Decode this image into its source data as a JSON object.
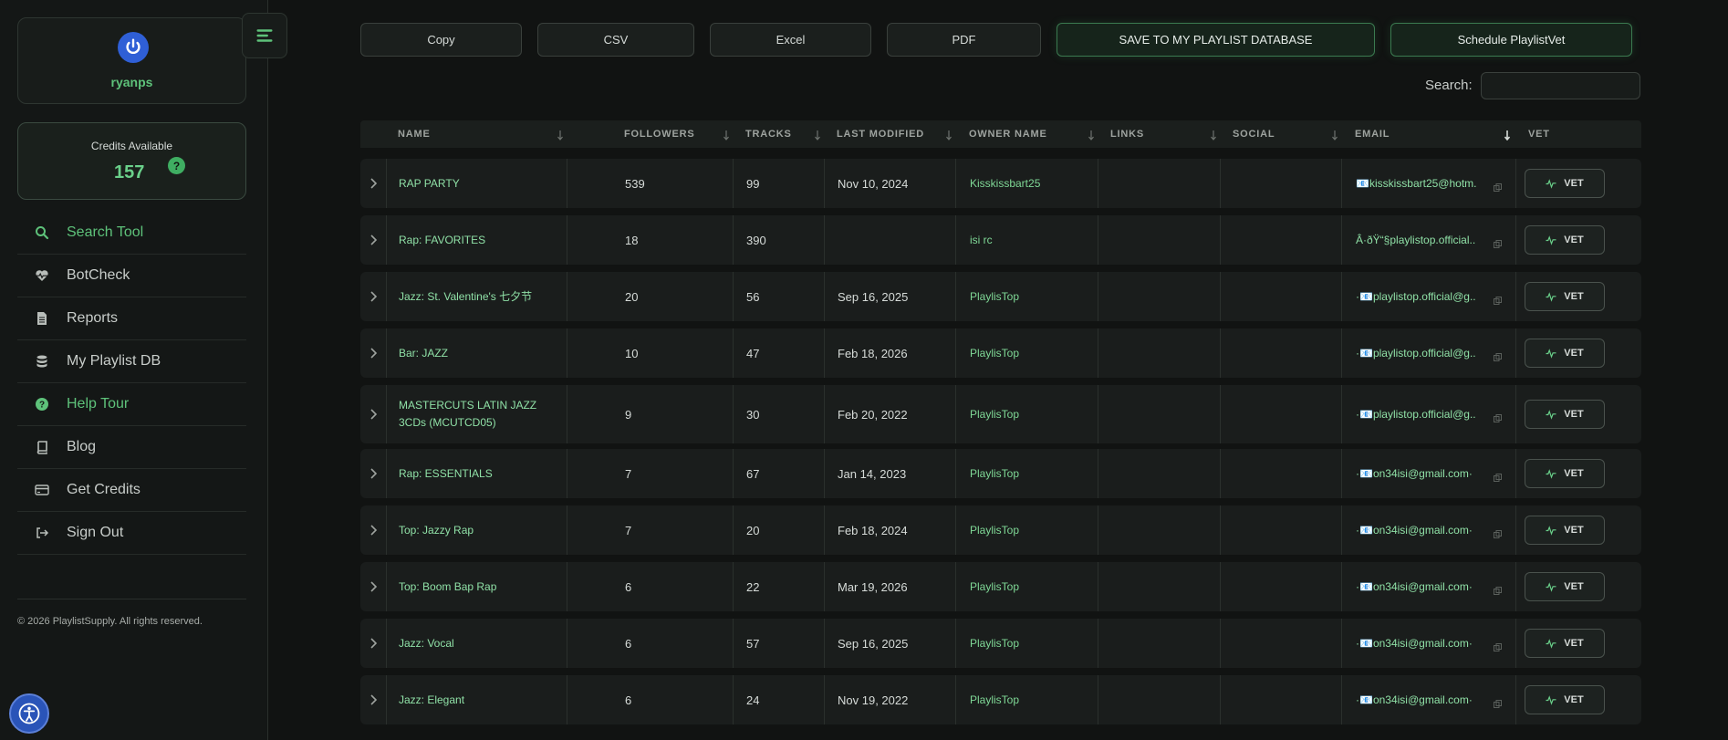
{
  "sidebar": {
    "username": "ryanps",
    "credits_label": "Credits Available",
    "credits_value": "157",
    "help_badge": "?",
    "nav": [
      {
        "label": "Search Tool",
        "icon": "search-icon",
        "state": "active"
      },
      {
        "label": "BotCheck",
        "icon": "heart-pulse-icon",
        "state": ""
      },
      {
        "label": "Reports",
        "icon": "document-icon",
        "state": ""
      },
      {
        "label": "My Playlist DB",
        "icon": "database-icon",
        "state": ""
      },
      {
        "label": "Help Tour",
        "icon": "question-circle-icon",
        "state": "accent"
      },
      {
        "label": "Blog",
        "icon": "book-icon",
        "state": ""
      },
      {
        "label": "Get Credits",
        "icon": "credit-card-icon",
        "state": ""
      },
      {
        "label": "Sign Out",
        "icon": "sign-out-icon",
        "state": ""
      }
    ],
    "copyright": "© 2026 PlaylistSupply. All rights reserved."
  },
  "toolbar": {
    "copy": "Copy",
    "csv": "CSV",
    "excel": "Excel",
    "pdf": "PDF",
    "save_db": "SAVE TO MY PLAYLIST DATABASE",
    "schedule": "Schedule PlaylistVet"
  },
  "search": {
    "label": "Search:",
    "value": ""
  },
  "table": {
    "columns": [
      "NAME",
      "FOLLOWERS",
      "TRACKS",
      "LAST MODIFIED",
      "OWNER NAME",
      "LINKS",
      "SOCIAL",
      "EMAIL",
      "VET"
    ],
    "vet_label": "VET",
    "rows": [
      {
        "name": "RAP PARTY",
        "followers": "539",
        "tracks": "99",
        "last_modified": "Nov 10, 2024",
        "owner": "Kisskissbart25",
        "links": "",
        "social": "",
        "email": "📧kisskissbart25@hotm..."
      },
      {
        "name": "Rap: FAVORITES",
        "followers": "18",
        "tracks": "390",
        "last_modified": "",
        "owner": "isi rc",
        "links": "",
        "social": "",
        "email": "Â·ðŸ“§playlistop.official..."
      },
      {
        "name": "Jazz: St. Valentine's 七夕节",
        "followers": "20",
        "tracks": "56",
        "last_modified": "Sep 16, 2025",
        "owner": "PlaylisTop",
        "links": "",
        "social": "",
        "email": "·📧playlistop.official@g..."
      },
      {
        "name": "Bar: JAZZ",
        "followers": "10",
        "tracks": "47",
        "last_modified": "Feb 18, 2026",
        "owner": "PlaylisTop",
        "links": "",
        "social": "",
        "email": "·📧playlistop.official@g..."
      },
      {
        "name": "MASTERCUTS LATIN JAZZ 3CDs (MCUTCD05)",
        "followers": "9",
        "tracks": "30",
        "last_modified": "Feb 20, 2022",
        "owner": "PlaylisTop",
        "links": "",
        "social": "",
        "email": "·📧playlistop.official@g..."
      },
      {
        "name": "Rap: ESSENTIALS",
        "followers": "7",
        "tracks": "67",
        "last_modified": "Jan 14, 2023",
        "owner": "PlaylisTop",
        "links": "",
        "social": "",
        "email": "·📧on34isi@gmail.com·"
      },
      {
        "name": "Top: Jazzy Rap",
        "followers": "7",
        "tracks": "20",
        "last_modified": "Feb 18, 2024",
        "owner": "PlaylisTop",
        "links": "",
        "social": "",
        "email": "·📧on34isi@gmail.com·"
      },
      {
        "name": "Top: Boom Bap Rap",
        "followers": "6",
        "tracks": "22",
        "last_modified": "Mar 19, 2026",
        "owner": "PlaylisTop",
        "links": "",
        "social": "",
        "email": "·📧on34isi@gmail.com·"
      },
      {
        "name": "Jazz: Vocal",
        "followers": "6",
        "tracks": "57",
        "last_modified": "Sep 16, 2025",
        "owner": "PlaylisTop",
        "links": "",
        "social": "",
        "email": "·📧on34isi@gmail.com·"
      },
      {
        "name": "Jazz: Elegant",
        "followers": "6",
        "tracks": "24",
        "last_modified": "Nov 19, 2022",
        "owner": "PlaylisTop",
        "links": "",
        "social": "",
        "email": "·📧on34isi@gmail.com·"
      }
    ]
  },
  "colors": {
    "accent": "#5ec27a",
    "background": "#111312",
    "row": "#1a1d1c"
  }
}
